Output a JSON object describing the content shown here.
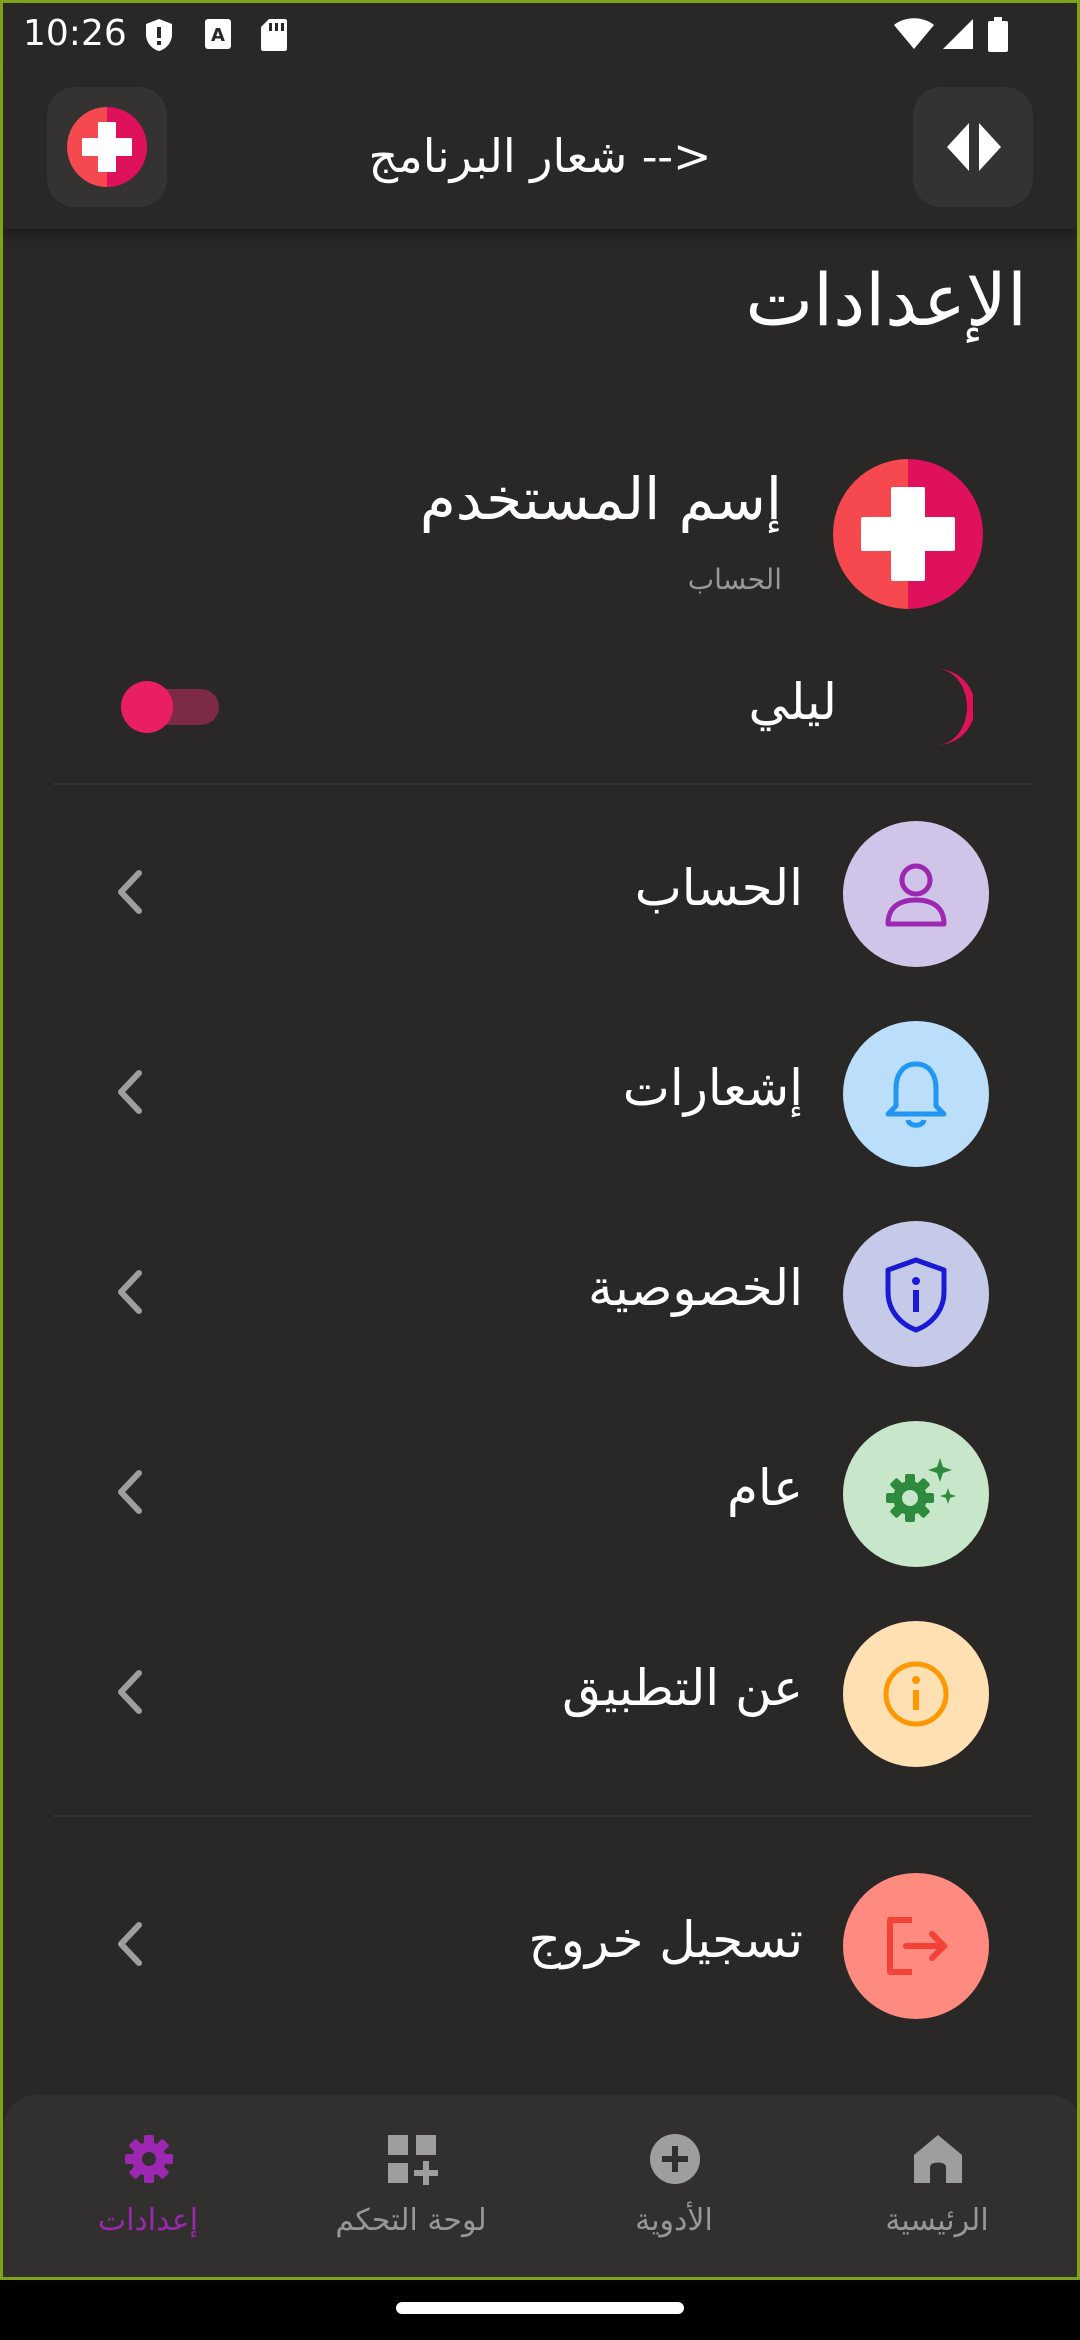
{
  "status_bar": {
    "time": "10:26"
  },
  "app_bar": {
    "title": "شعار البرنامج -->"
  },
  "page": {
    "heading": "الإعدادات"
  },
  "profile": {
    "username": "إسم المستخدم",
    "subtitle": "الحساب"
  },
  "dark_mode": {
    "label": "ليلي",
    "enabled": true
  },
  "menu": [
    {
      "label": "الحساب",
      "icon": "person-icon",
      "bg": "#d1c4e9",
      "fg": "#9c27b0"
    },
    {
      "label": "إشعارات",
      "icon": "bell-icon",
      "bg": "#bbdefb",
      "fg": "#2196f3"
    },
    {
      "label": "الخصوصية",
      "icon": "shield-info-icon",
      "bg": "#c5cae9",
      "fg": "#1a1ad6"
    },
    {
      "label": "عام",
      "icon": "gear-sparkle-icon",
      "bg": "#c8e6c9",
      "fg": "#2e8b3e"
    },
    {
      "label": "عن التطبيق",
      "icon": "info-icon",
      "bg": "#ffe0b2",
      "fg": "#ff9800"
    }
  ],
  "logout": {
    "label": "تسجيل خروج",
    "icon": "logout-icon",
    "bg": "#ff8a80",
    "fg": "#f44336"
  },
  "bottom_nav": [
    {
      "label": "إعدادات",
      "icon": "gear-icon",
      "active": true
    },
    {
      "label": "لوحة التحكم",
      "icon": "dashboard-add-icon",
      "active": false
    },
    {
      "label": "الأدوية",
      "icon": "plus-circle-icon",
      "active": false
    },
    {
      "label": "الرئيسية",
      "icon": "home-icon",
      "active": false
    }
  ],
  "colors": {
    "background": "#2a2727",
    "accent": "#e91e63",
    "active_nav": "#9c27b0"
  }
}
